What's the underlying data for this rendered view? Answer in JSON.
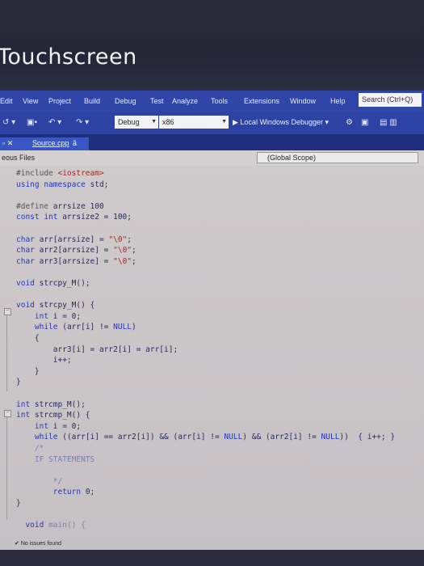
{
  "window": {
    "title": "Touchscreen"
  },
  "menu": [
    "Edit",
    "View",
    "Project",
    "Build",
    "Debug",
    "Test",
    "Analyze",
    "Tools",
    "Extensions",
    "Window",
    "Help"
  ],
  "search": {
    "placeholder": "Search (Ctrl+Q)"
  },
  "toolbar": {
    "config": "Debug",
    "platform": "x86",
    "run_label": "Local Windows Debugger"
  },
  "tab": {
    "filename": "Source.cpp",
    "pin": "ā"
  },
  "nav": {
    "project": "eous Files",
    "scope": "(Global Scope)"
  },
  "code": [
    {
      "t": [
        [
          "pp",
          "#include "
        ],
        [
          "str",
          "<iostream>"
        ]
      ]
    },
    {
      "t": [
        [
          "kw",
          "using namespace "
        ],
        [
          "",
          "std;"
        ]
      ]
    },
    {
      "t": []
    },
    {
      "t": [
        [
          "pp",
          "#define "
        ],
        [
          "",
          "arrsize 100"
        ]
      ]
    },
    {
      "t": [
        [
          "kw",
          "const int "
        ],
        [
          "",
          "arrsize2 = 100;"
        ]
      ]
    },
    {
      "t": []
    },
    {
      "t": [
        [
          "kw",
          "char "
        ],
        [
          "",
          "arr[arrsize] = "
        ],
        [
          "str",
          "\"\\0\""
        ],
        [
          "",
          ";"
        ]
      ]
    },
    {
      "t": [
        [
          "kw",
          "char "
        ],
        [
          "",
          "arr2[arrsize] = "
        ],
        [
          "str",
          "\"\\0\""
        ],
        [
          "",
          ";"
        ]
      ]
    },
    {
      "t": [
        [
          "kw",
          "char "
        ],
        [
          "",
          "arr3[arrsize] = "
        ],
        [
          "str",
          "\"\\0\""
        ],
        [
          "",
          ";"
        ]
      ]
    },
    {
      "t": []
    },
    {
      "t": [
        [
          "kw",
          "void "
        ],
        [
          "",
          "strcpy_M();"
        ]
      ]
    },
    {
      "t": []
    },
    {
      "t": [
        [
          "kw",
          "void "
        ],
        [
          "",
          "strcpy_M() {"
        ]
      ]
    },
    {
      "t": [
        [
          "",
          "    "
        ],
        [
          "kw",
          "int "
        ],
        [
          "",
          "i = 0;"
        ]
      ]
    },
    {
      "t": [
        [
          "",
          "    "
        ],
        [
          "kw",
          "while "
        ],
        [
          "",
          "(arr[i] != "
        ],
        [
          "kw",
          "NULL"
        ],
        [
          "",
          ")"
        ]
      ]
    },
    {
      "t": [
        [
          "",
          "    {"
        ]
      ]
    },
    {
      "t": [
        [
          "",
          "        arr3[i] = arr2[i] = arr[i];"
        ]
      ]
    },
    {
      "t": [
        [
          "",
          "        i++;"
        ]
      ]
    },
    {
      "t": [
        [
          "",
          "    }"
        ]
      ]
    },
    {
      "t": [
        [
          "",
          "}"
        ]
      ]
    },
    {
      "t": []
    },
    {
      "t": [
        [
          "kw",
          "int "
        ],
        [
          "",
          "strcmp_M();"
        ]
      ]
    },
    {
      "t": [
        [
          "kw",
          "int "
        ],
        [
          "",
          "strcmp_M() {"
        ]
      ]
    },
    {
      "t": [
        [
          "",
          "    "
        ],
        [
          "kw",
          "int "
        ],
        [
          "",
          "i = 0;"
        ]
      ]
    },
    {
      "t": [
        [
          "",
          "    "
        ],
        [
          "kw",
          "while "
        ],
        [
          "",
          "((arr[i] == arr2[i]) && (arr[i] != "
        ],
        [
          "kw",
          "NULL"
        ],
        [
          "",
          ") && (arr2[i] != "
        ],
        [
          "kw",
          "NULL"
        ],
        [
          "",
          "))  { i++; }"
        ]
      ]
    },
    {
      "t": [
        [
          "",
          "    "
        ],
        [
          "dim",
          "/*"
        ]
      ]
    },
    {
      "t": [
        [
          "",
          "    "
        ],
        [
          "dim",
          "IF STATEMENTS"
        ]
      ]
    },
    {
      "t": []
    },
    {
      "t": [
        [
          "",
          "        "
        ],
        [
          "dim",
          "*/"
        ]
      ]
    },
    {
      "t": [
        [
          "",
          "        "
        ],
        [
          "kw",
          "return "
        ],
        [
          "",
          "0;"
        ]
      ]
    },
    {
      "t": [
        [
          "",
          "}"
        ]
      ]
    },
    {
      "t": []
    },
    {
      "t": [
        [
          "",
          "  "
        ],
        [
          "kw",
          "void "
        ],
        [
          "dim",
          "main() {"
        ]
      ]
    }
  ],
  "status": {
    "issues": "No issues found"
  }
}
